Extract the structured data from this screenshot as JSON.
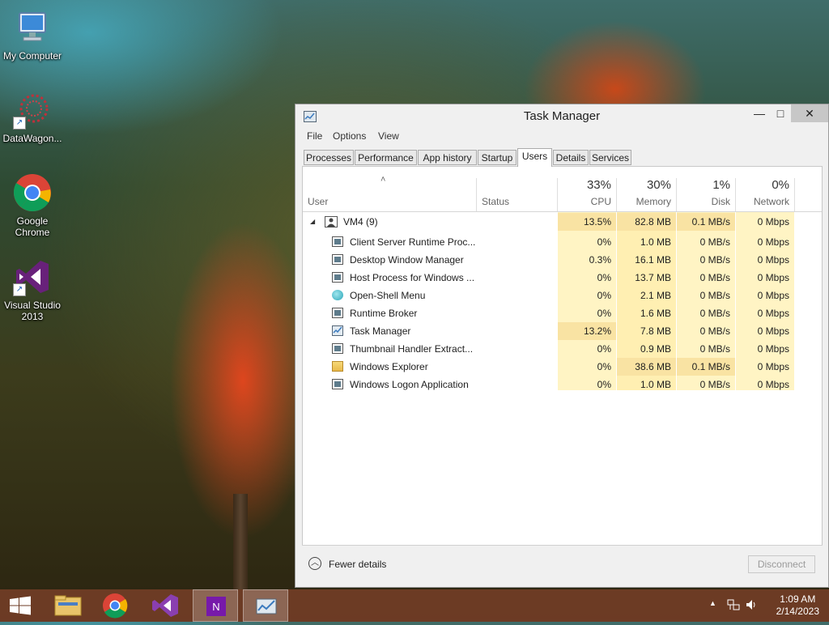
{
  "desktop": {
    "icons": [
      {
        "label": "My Computer",
        "icon": "computer-icon"
      },
      {
        "label": "DataWagon...",
        "icon": "datawagon-icon"
      },
      {
        "label": "Google Chrome",
        "icon": "chrome-icon"
      },
      {
        "label": "Visual Studio 2013",
        "icon": "visual-studio-icon"
      }
    ]
  },
  "window": {
    "title": "Task Manager",
    "controls": {
      "minimize": "—",
      "maximize": "□",
      "close": "✕"
    },
    "menu": [
      "File",
      "Options",
      "View"
    ],
    "tabs": [
      "Processes",
      "Performance",
      "App history",
      "Startup",
      "Users",
      "Details",
      "Services"
    ],
    "active_tab": "Users",
    "columns": {
      "user": {
        "label": "User"
      },
      "status": {
        "label": "Status"
      },
      "cpu": {
        "label": "CPU",
        "pct": "33%"
      },
      "memory": {
        "label": "Memory",
        "pct": "30%"
      },
      "disk": {
        "label": "Disk",
        "pct": "1%"
      },
      "network": {
        "label": "Network",
        "pct": "0%"
      }
    },
    "sort_indicator": "˄",
    "user_group": {
      "name": "VM4 (9)",
      "cpu": "13.5%",
      "memory": "82.8 MB",
      "disk": "0.1 MB/s",
      "network": "0 Mbps"
    },
    "processes": [
      {
        "name": "Client Server Runtime Proc...",
        "cpu": "0%",
        "memory": "1.0 MB",
        "disk": "0 MB/s",
        "network": "0 Mbps",
        "icon": "process-window-icon"
      },
      {
        "name": "Desktop Window Manager",
        "cpu": "0.3%",
        "memory": "16.1 MB",
        "disk": "0 MB/s",
        "network": "0 Mbps",
        "icon": "process-window-icon"
      },
      {
        "name": "Host Process for Windows ...",
        "cpu": "0%",
        "memory": "13.7 MB",
        "disk": "0 MB/s",
        "network": "0 Mbps",
        "icon": "process-window-icon"
      },
      {
        "name": "Open-Shell Menu",
        "cpu": "0%",
        "memory": "2.1 MB",
        "disk": "0 MB/s",
        "network": "0 Mbps",
        "icon": "open-shell-icon"
      },
      {
        "name": "Runtime Broker",
        "cpu": "0%",
        "memory": "1.6 MB",
        "disk": "0 MB/s",
        "network": "0 Mbps",
        "icon": "process-window-icon"
      },
      {
        "name": "Task Manager",
        "cpu": "13.2%",
        "memory": "7.8 MB",
        "disk": "0 MB/s",
        "network": "0 Mbps",
        "icon": "task-manager-icon"
      },
      {
        "name": "Thumbnail Handler Extract...",
        "cpu": "0%",
        "memory": "0.9 MB",
        "disk": "0 MB/s",
        "network": "0 Mbps",
        "icon": "process-window-icon"
      },
      {
        "name": "Windows Explorer",
        "cpu": "0%",
        "memory": "38.6 MB",
        "disk": "0.1 MB/s",
        "network": "0 Mbps",
        "icon": "folder-icon"
      },
      {
        "name": "Windows Logon Application",
        "cpu": "0%",
        "memory": "1.0 MB",
        "disk": "0 MB/s",
        "network": "0 Mbps",
        "icon": "process-window-icon"
      }
    ],
    "footer": {
      "fewer_details": "Fewer details",
      "disconnect": "Disconnect"
    }
  },
  "colors": {
    "heat_light": "#fff4c4",
    "heat_mid": "#ffe8a0",
    "heat_strong": "#f9e6a2",
    "taskbar": "#703c26"
  },
  "taskbar": {
    "items": [
      {
        "icon": "windows-start-icon"
      },
      {
        "icon": "file-explorer-icon"
      },
      {
        "icon": "chrome-icon"
      },
      {
        "icon": "visual-studio-icon"
      },
      {
        "icon": "onenote-icon",
        "active": true
      },
      {
        "icon": "task-manager-icon",
        "active": true
      }
    ],
    "tray": {
      "time": "1:09 AM",
      "date": "2/14/2023"
    }
  }
}
